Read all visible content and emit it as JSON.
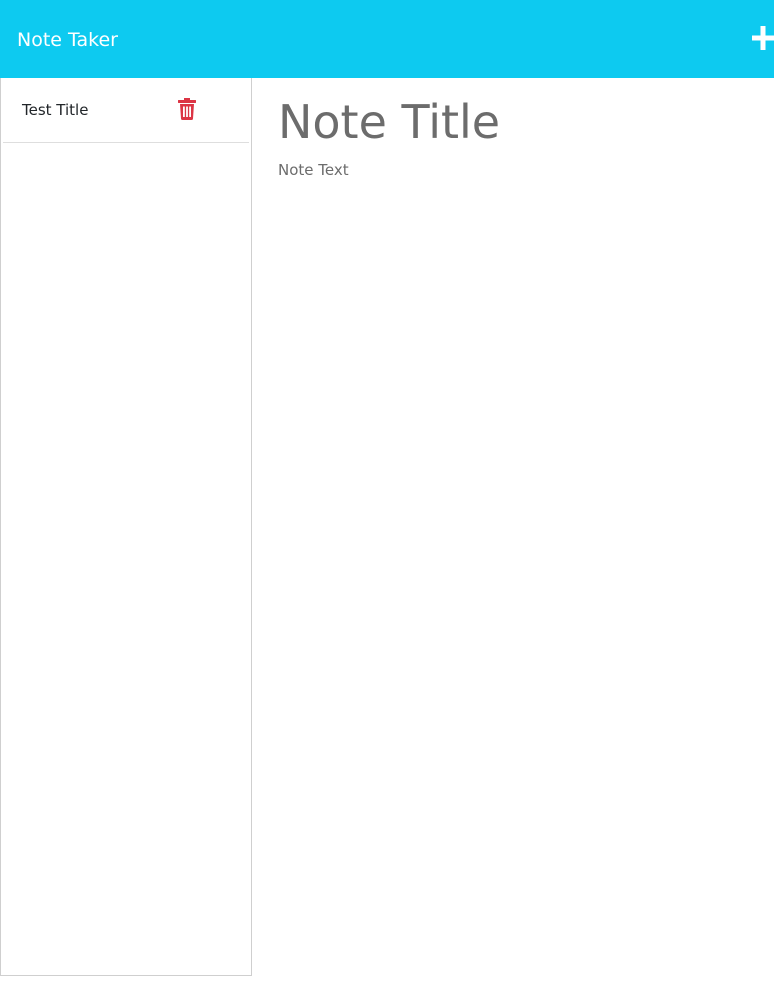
{
  "app": {
    "brand": "Note Taker",
    "accent_color": "#0dcaf0"
  },
  "toolbar": {
    "new_note_icon": "plus-icon"
  },
  "sidebar": {
    "notes": [
      {
        "title": "Test Title",
        "delete_icon": "trash-icon",
        "delete_color": "#dc3545"
      }
    ]
  },
  "editor": {
    "title_placeholder": "Note Title",
    "text_placeholder": "Note Text"
  }
}
